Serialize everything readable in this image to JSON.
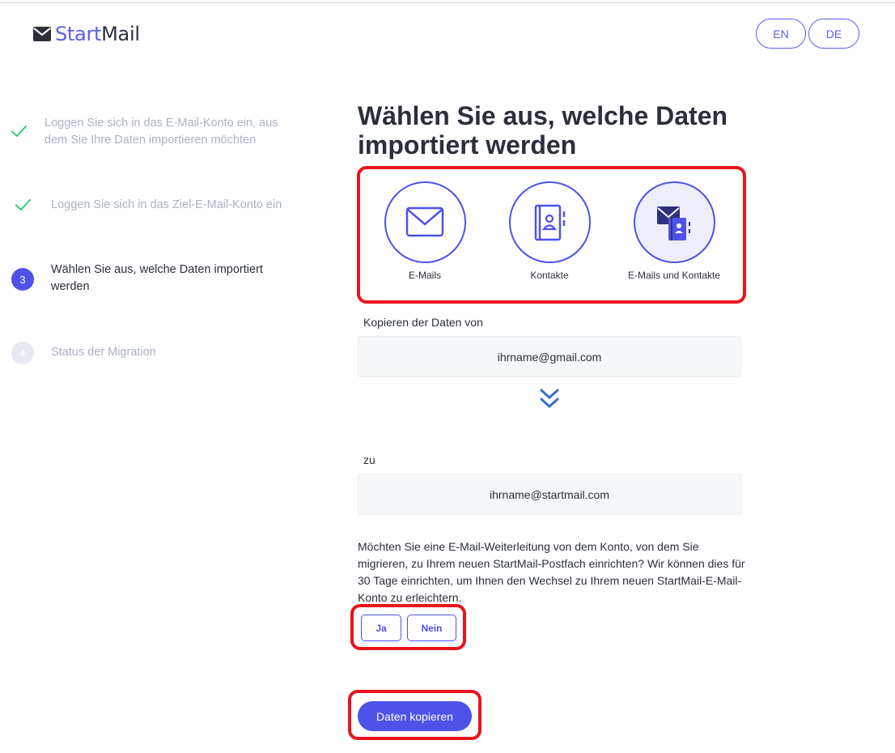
{
  "header": {
    "logo_start": "Start",
    "logo_mail": "Mail",
    "lang_en": "EN",
    "lang_de": "DE"
  },
  "steps": [
    {
      "number": "1",
      "state": "done",
      "label": "Loggen Sie sich in das E-Mail-Konto ein, aus dem Sie Ihre Daten importieren möchten"
    },
    {
      "number": "2",
      "state": "done",
      "label": "Loggen Sie sich in das Ziel-E-Mail-Konto ein"
    },
    {
      "number": "3",
      "state": "active",
      "label": "Wählen Sie aus, welche Daten importiert werden"
    },
    {
      "number": "4",
      "state": "pending",
      "label": "Status der Migration"
    }
  ],
  "main": {
    "title": "Wählen Sie aus, welche Daten importiert werden",
    "options": [
      {
        "label": "E-Mails",
        "icon": "envelope-icon",
        "selected": false
      },
      {
        "label": "Kontakte",
        "icon": "contact-book-icon",
        "selected": false
      },
      {
        "label": "E-Mails und Kontakte",
        "icon": "emails-and-contacts-icon",
        "selected": true
      }
    ],
    "source_label": "Kopieren der Daten von",
    "source_value": "ihrname@gmail.com",
    "target_label": "zu",
    "target_value": "ihrname@startmail.com",
    "forward_question": "Möchten Sie eine E-Mail-Weiterleitung von dem Konto, von dem Sie migrieren, zu Ihrem neuen StartMail-Postfach einrichten? Wir können dies für 30 Tage einrichten, um Ihnen den Wechsel zu Ihrem neuen StartMail-E-Mail-Konto zu erleichtern.",
    "yes_label": "Ja",
    "no_label": "Nein",
    "copy_label": "Daten kopieren"
  },
  "colors": {
    "accent": "#4f52e8",
    "highlight": "#e8141c",
    "check": "#2ecc71"
  }
}
